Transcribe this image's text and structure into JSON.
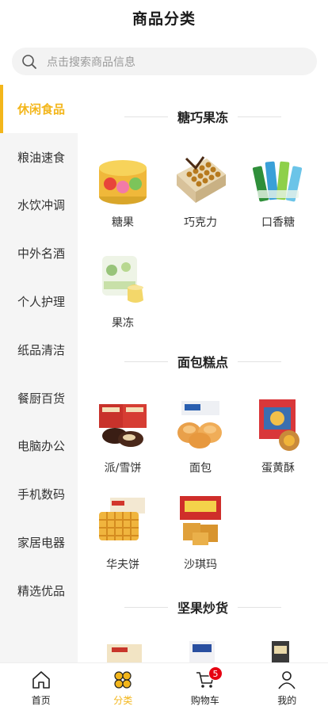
{
  "header": {
    "title": "商品分类"
  },
  "search": {
    "placeholder": "点击搜索商品信息"
  },
  "sidebar": {
    "items": [
      {
        "label": "休闲食品",
        "active": true
      },
      {
        "label": "粮油速食"
      },
      {
        "label": "水饮冲调"
      },
      {
        "label": "中外名酒"
      },
      {
        "label": "个人护理"
      },
      {
        "label": "纸品清洁"
      },
      {
        "label": "餐厨百货"
      },
      {
        "label": "电脑办公"
      },
      {
        "label": "手机数码"
      },
      {
        "label": "家居电器"
      },
      {
        "label": "精选优品"
      }
    ]
  },
  "sections": [
    {
      "title": "糖巧果冻",
      "products": [
        {
          "label": "糖果"
        },
        {
          "label": "巧克力"
        },
        {
          "label": "口香糖"
        },
        {
          "label": "果冻"
        }
      ]
    },
    {
      "title": "面包糕点",
      "products": [
        {
          "label": "派/雪饼"
        },
        {
          "label": "面包"
        },
        {
          "label": "蛋黄酥"
        },
        {
          "label": "华夫饼"
        },
        {
          "label": "沙琪玛"
        }
      ]
    },
    {
      "title": "坚果炒货",
      "products": []
    }
  ],
  "tabbar": {
    "tabs": [
      {
        "label": "首页"
      },
      {
        "label": "分类",
        "active": true
      },
      {
        "label": "购物车",
        "badge": "5"
      },
      {
        "label": "我的"
      }
    ]
  },
  "colors": {
    "accent": "#f3b61b",
    "badge": "#e60012"
  }
}
